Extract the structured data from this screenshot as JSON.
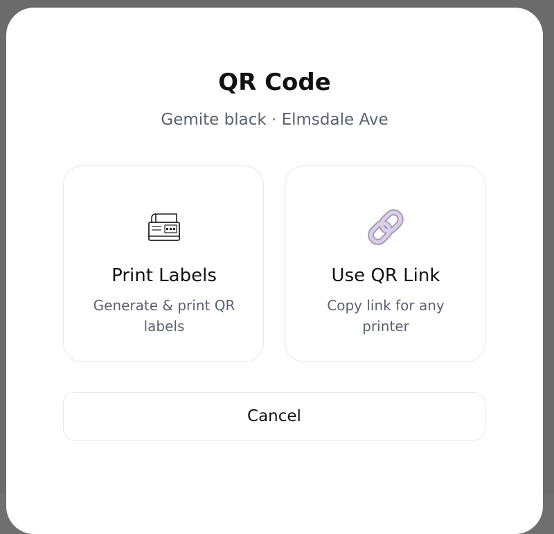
{
  "modal": {
    "title": "QR Code",
    "subtitle": "Gemite black · Elmsdale Ave",
    "options": [
      {
        "icon": "label-printer-icon",
        "title": "Print Labels",
        "description": "Generate & print QR labels"
      },
      {
        "icon": "link-icon",
        "title": "Use QR Link",
        "description": "Copy link for any printer"
      }
    ],
    "cancel_label": "Cancel"
  },
  "colors": {
    "backdrop": "#6b6b6b",
    "modal_bg": "#ffffff",
    "text_primary": "#111111",
    "text_secondary": "#5a6170",
    "border": "#e5e6ea",
    "link_icon": "#cbbfd9"
  }
}
